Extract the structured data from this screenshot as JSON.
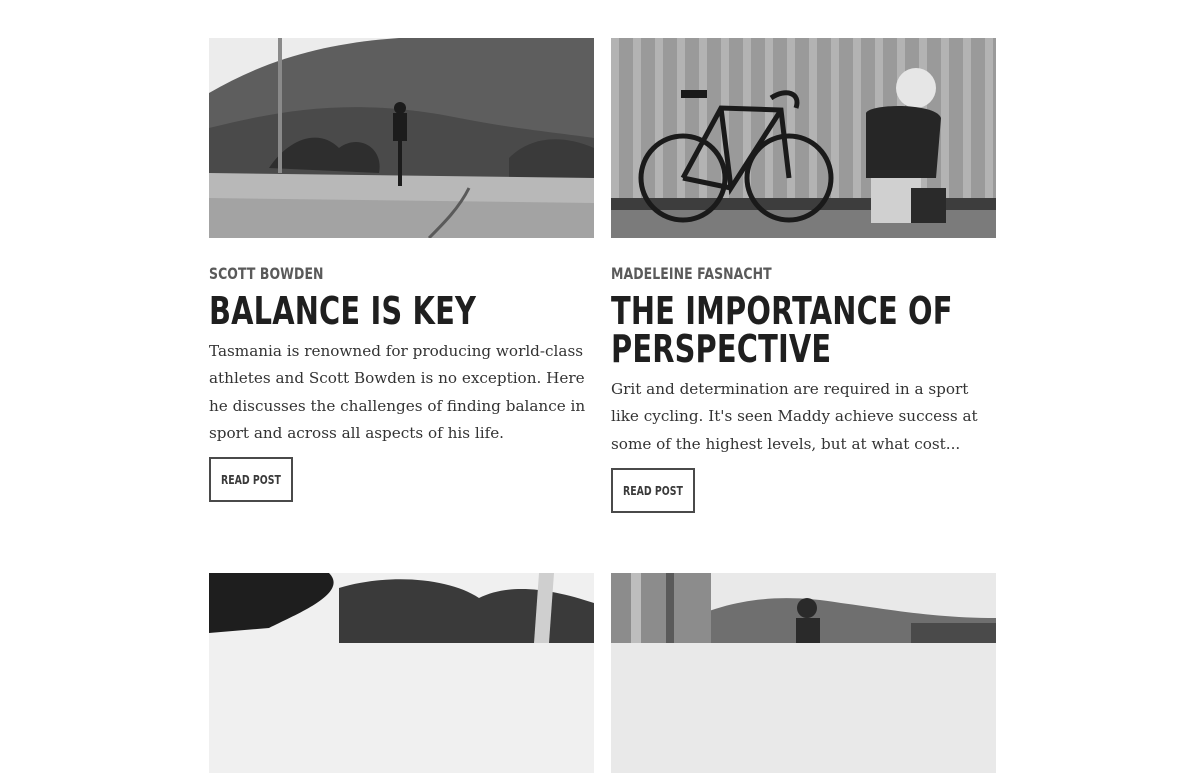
{
  "posts": [
    {
      "author": "SCOTT BOWDEN",
      "title": "BALANCE IS KEY",
      "excerpt": "Tasmania is renowned for producing world-class athletes and Scott Bowden is no exception. Here he discusses the challenges of finding balance in sport and across all aspects of his life.",
      "button": "READ POST",
      "image": "cyclist-mountain-road-photo"
    },
    {
      "author": "MADELEINE FASNACHT",
      "title": "THE IMPORTANCE OF PERSPECTIVE",
      "excerpt": "Grit and determination are required in a sport like cycling. It's seen Maddy achieve success at some of the highest levels, but at what cost...",
      "button": "READ POST",
      "image": "cyclist-with-bike-container-photo"
    },
    {
      "image": "trees-landscape-photo"
    },
    {
      "image": "person-mountain-view-photo"
    }
  ]
}
